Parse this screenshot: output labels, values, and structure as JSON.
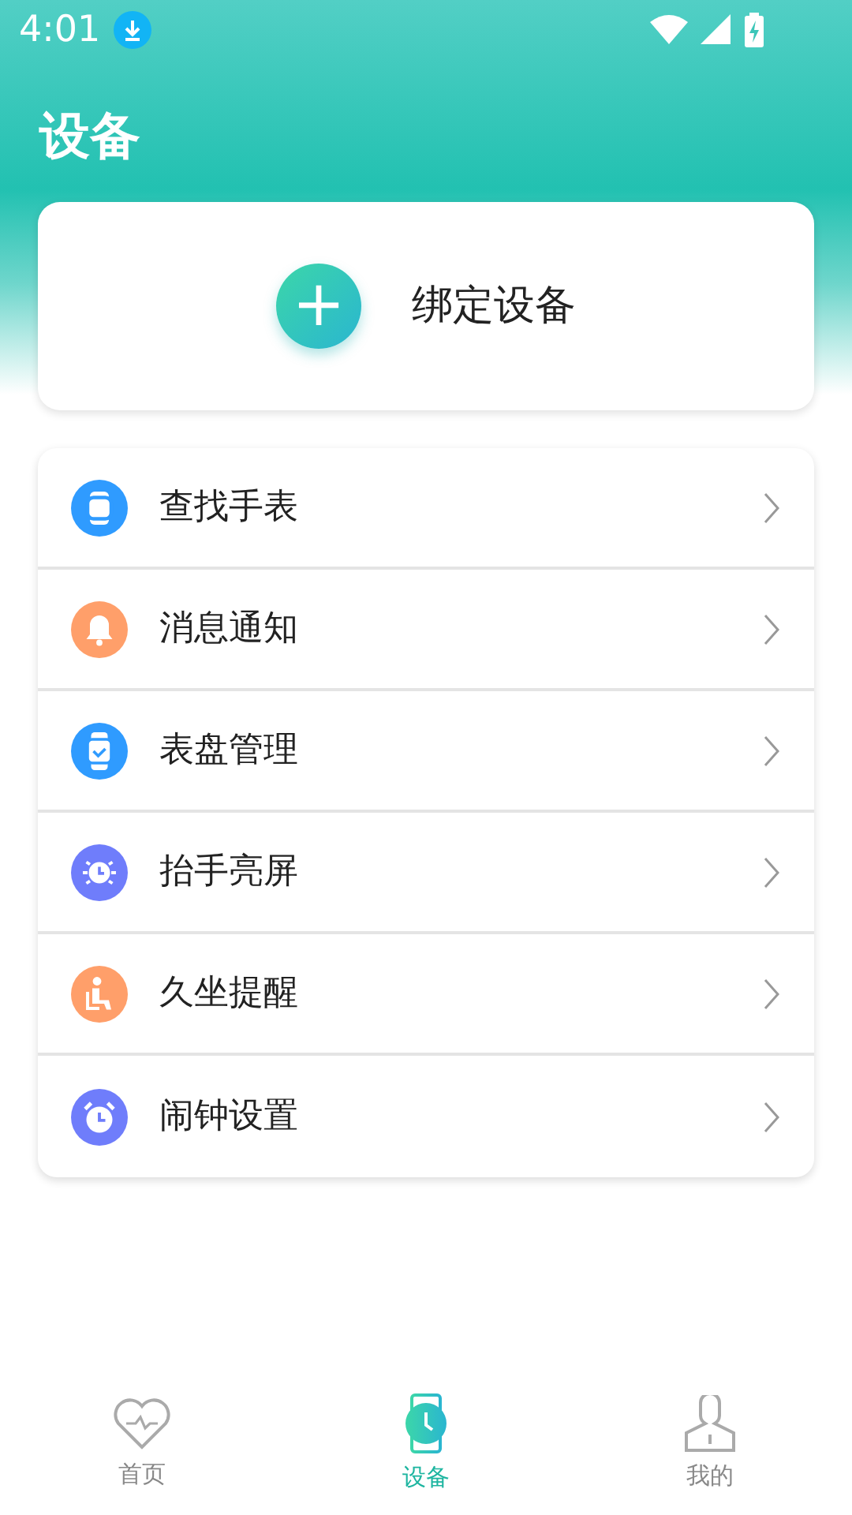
{
  "status_bar": {
    "time": "4:01"
  },
  "header": {
    "title": "设备"
  },
  "bind_card": {
    "label": "绑定设备",
    "icon": "+"
  },
  "menu": [
    {
      "label": "查找手表",
      "color": "#2f9bff"
    },
    {
      "label": "消息通知",
      "color": "#ff9f6a"
    },
    {
      "label": "表盘管理",
      "color": "#2f9bff"
    },
    {
      "label": "抬手亮屏",
      "color": "#6f7dfb"
    },
    {
      "label": "久坐提醒",
      "color": "#ff9f6a"
    },
    {
      "label": "闹钟设置",
      "color": "#6f7dfb"
    }
  ],
  "bottom_nav": [
    {
      "label": "首页",
      "selected": false
    },
    {
      "label": "设备",
      "selected": true
    },
    {
      "label": "我的",
      "selected": false
    }
  ]
}
